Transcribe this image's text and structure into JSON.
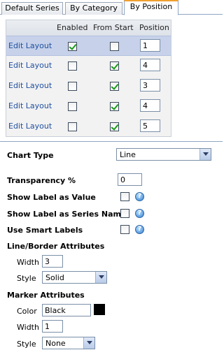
{
  "tabs": [
    {
      "label": "Default Series",
      "active": false
    },
    {
      "label": "By Category",
      "active": false
    },
    {
      "label": "By Position",
      "active": true
    }
  ],
  "grid": {
    "columns": [
      "Enabled",
      "From Start",
      "Position"
    ],
    "rows": [
      {
        "link": "Edit Layout",
        "enabled": true,
        "from_start": false,
        "position": "1",
        "selected": true
      },
      {
        "link": "Edit Layout",
        "enabled": false,
        "from_start": true,
        "position": "4",
        "selected": false
      },
      {
        "link": "Edit Layout",
        "enabled": false,
        "from_start": true,
        "position": "3",
        "selected": false
      },
      {
        "link": "Edit Layout",
        "enabled": false,
        "from_start": true,
        "position": "4",
        "selected": false
      },
      {
        "link": "Edit Layout",
        "enabled": false,
        "from_start": true,
        "position": "5",
        "selected": false
      }
    ]
  },
  "form": {
    "chart_type_label": "Chart Type",
    "chart_type_value": "Line",
    "transparency_label": "Transparency %",
    "transparency_value": "0",
    "show_label_value_label": "Show Label as Value",
    "show_label_value_checked": false,
    "show_label_series_label": "Show Label as Series Name",
    "show_label_series_checked": false,
    "smart_labels_label": "Use Smart Labels",
    "smart_labels_checked": false,
    "help_glyph": "?",
    "line_border_heading": "Line/Border Attributes",
    "line_width_label": "Width",
    "line_width_value": "3",
    "line_style_label": "Style",
    "line_style_value": "Solid",
    "marker_heading": "Marker Attributes",
    "marker_color_label": "Color",
    "marker_color_value": "Black",
    "marker_swatch_color": "#000000",
    "marker_width_label": "Width",
    "marker_width_value": "1",
    "marker_style_label": "Style",
    "marker_style_value": "None"
  }
}
